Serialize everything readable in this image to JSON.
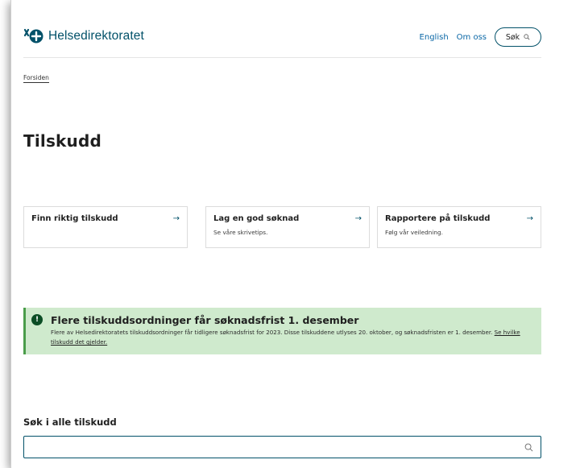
{
  "header": {
    "logo_text": "Helsedirektoratet",
    "nav": [
      {
        "label": "English"
      },
      {
        "label": "Om oss"
      }
    ],
    "search_label": "Søk"
  },
  "breadcrumb": {
    "home": "Forsiden"
  },
  "page": {
    "title": "Tilskudd"
  },
  "cards": [
    {
      "title": "Finn riktig tilskudd",
      "subtitle": "",
      "arrow": "→"
    },
    {
      "title": "Lag en god søknad",
      "subtitle": "Se våre skrivetips.",
      "arrow": "→"
    },
    {
      "title": "Rapportere på tilskudd",
      "subtitle": "Følg vår veiledning.",
      "arrow": "→"
    }
  ],
  "alert": {
    "icon": "!",
    "title": "Flere tilskuddsordninger får søknadsfrist 1. desember",
    "body": "Flere av Helsedirektoratets tilskuddsordninger får tidligere søknadsfrist for 2023. Disse tilskuddene utlyses 20. oktober, og søknadsfristen er 1. desember.",
    "link": "Se hvilke tilskudd det gjelder."
  },
  "search": {
    "heading": "Søk i alle tilskudd",
    "value": "",
    "placeholder": ""
  },
  "colors": {
    "brand": "#025169",
    "link": "#0a67a6",
    "alert_bg": "#cfeacd",
    "alert_border": "#4a9d4a"
  }
}
